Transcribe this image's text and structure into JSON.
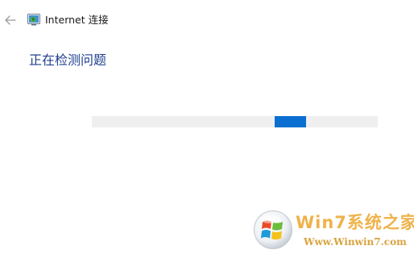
{
  "header": {
    "back_label": "←",
    "title": "Internet 连接",
    "title_icon": "network-connection-icon"
  },
  "main": {
    "heading": "正在检测问题"
  },
  "progress": {
    "state": "indeterminate",
    "chunk_position_fraction": 0.64,
    "chunk_width_fraction": 0.11,
    "track_color": "#efefef",
    "chunk_color": "#0a6fd0"
  },
  "watermark": {
    "brand": "Win7系统之家",
    "url": "Www.Winwin7.com",
    "logo": "windows-orb-icon"
  },
  "colors": {
    "heading": "#1f3f8f",
    "accent": "#0a6fd0"
  }
}
